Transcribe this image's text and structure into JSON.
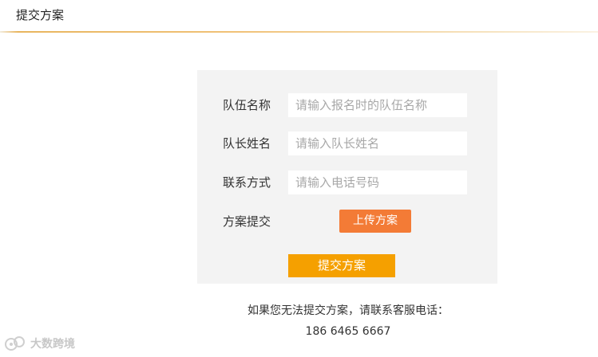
{
  "header": {
    "title": "提交方案"
  },
  "form": {
    "team_name": {
      "label": "队伍名称",
      "placeholder": "请输入报名时的队伍名称"
    },
    "captain_name": {
      "label": "队长姓名",
      "placeholder": "请输入队长姓名"
    },
    "contact": {
      "label": "联系方式",
      "placeholder": "请输入电话号码"
    },
    "plan_submit": {
      "label": "方案提交",
      "upload_button": "上传方案"
    },
    "submit_button": "提交方案"
  },
  "help": {
    "message": "如果您无法提交方案，请联系客服电话：",
    "phone": "186 6465 6667"
  },
  "watermark": {
    "text": "大数跨境"
  },
  "colors": {
    "upload_button": "#f37b36",
    "submit_button": "#f5a000",
    "panel_background": "#f3f3f3",
    "header_line": "#e8b55e"
  }
}
